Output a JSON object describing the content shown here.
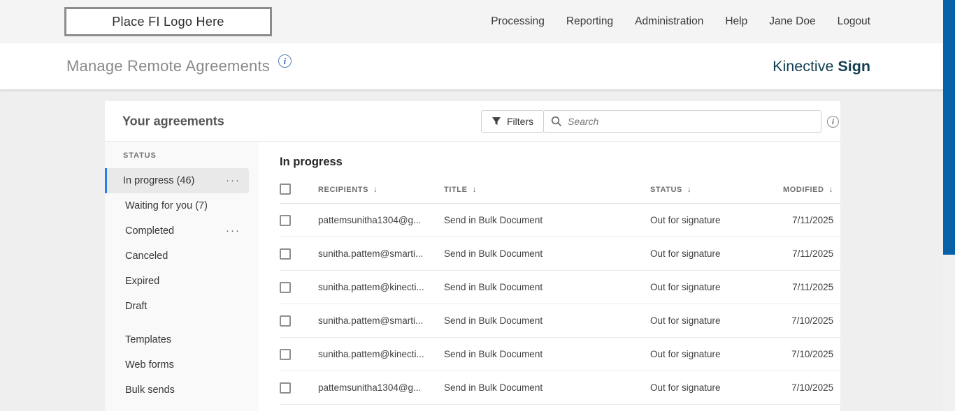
{
  "topbar": {
    "logo_placeholder": "Place FI Logo Here",
    "nav": [
      "Processing",
      "Reporting",
      "Administration",
      "Help",
      "Jane Doe",
      "Logout"
    ]
  },
  "header": {
    "title": "Manage Remote Agreements",
    "info_icon": "i",
    "brand_name": "Kinective",
    "brand_product": "Sign"
  },
  "panel": {
    "title": "Your agreements",
    "filters_label": "Filters",
    "search_placeholder": "Search",
    "info_icon": "i"
  },
  "sidebar": {
    "section_label": "STATUS",
    "status_items": [
      {
        "label": "In progress (46)",
        "selected": true,
        "has_menu": true
      },
      {
        "label": "Waiting for you (7)",
        "selected": false,
        "has_menu": false
      },
      {
        "label": "Completed",
        "selected": false,
        "has_menu": true
      },
      {
        "label": "Canceled",
        "selected": false,
        "has_menu": false
      },
      {
        "label": "Expired",
        "selected": false,
        "has_menu": false
      },
      {
        "label": "Draft",
        "selected": false,
        "has_menu": false
      }
    ],
    "other_items": [
      {
        "label": "Templates"
      },
      {
        "label": "Web forms"
      },
      {
        "label": "Bulk sends"
      }
    ]
  },
  "table": {
    "section_title": "In progress",
    "columns": [
      "RECIPIENTS",
      "TITLE",
      "STATUS",
      "MODIFIED"
    ],
    "sort_arrow": "↓",
    "rows": [
      {
        "recipients": "pattemsunitha1304@g...",
        "title": "Send in Bulk Document",
        "status": "Out for signature",
        "modified": "7/11/2025"
      },
      {
        "recipients": "sunitha.pattem@smarti...",
        "title": "Send in Bulk Document",
        "status": "Out for signature",
        "modified": "7/11/2025"
      },
      {
        "recipients": "sunitha.pattem@kinecti...",
        "title": "Send in Bulk Document",
        "status": "Out for signature",
        "modified": "7/11/2025"
      },
      {
        "recipients": "sunitha.pattem@smarti...",
        "title": "Send in Bulk Document",
        "status": "Out for signature",
        "modified": "7/10/2025"
      },
      {
        "recipients": "sunitha.pattem@kinecti...",
        "title": "Send in Bulk Document",
        "status": "Out for signature",
        "modified": "7/10/2025"
      },
      {
        "recipients": "pattemsunitha1304@g...",
        "title": "Send in Bulk Document",
        "status": "Out for signature",
        "modified": "7/10/2025"
      }
    ]
  },
  "colors": {
    "accent_blue": "#2680eb",
    "scrollbar_blue": "#0562a8",
    "brand_teal": "#123f51",
    "topbar_bg": "#f4f4f4",
    "page_bg": "#efefef",
    "selected_item_bg": "#e9e9e9"
  },
  "menu_dots": "···"
}
